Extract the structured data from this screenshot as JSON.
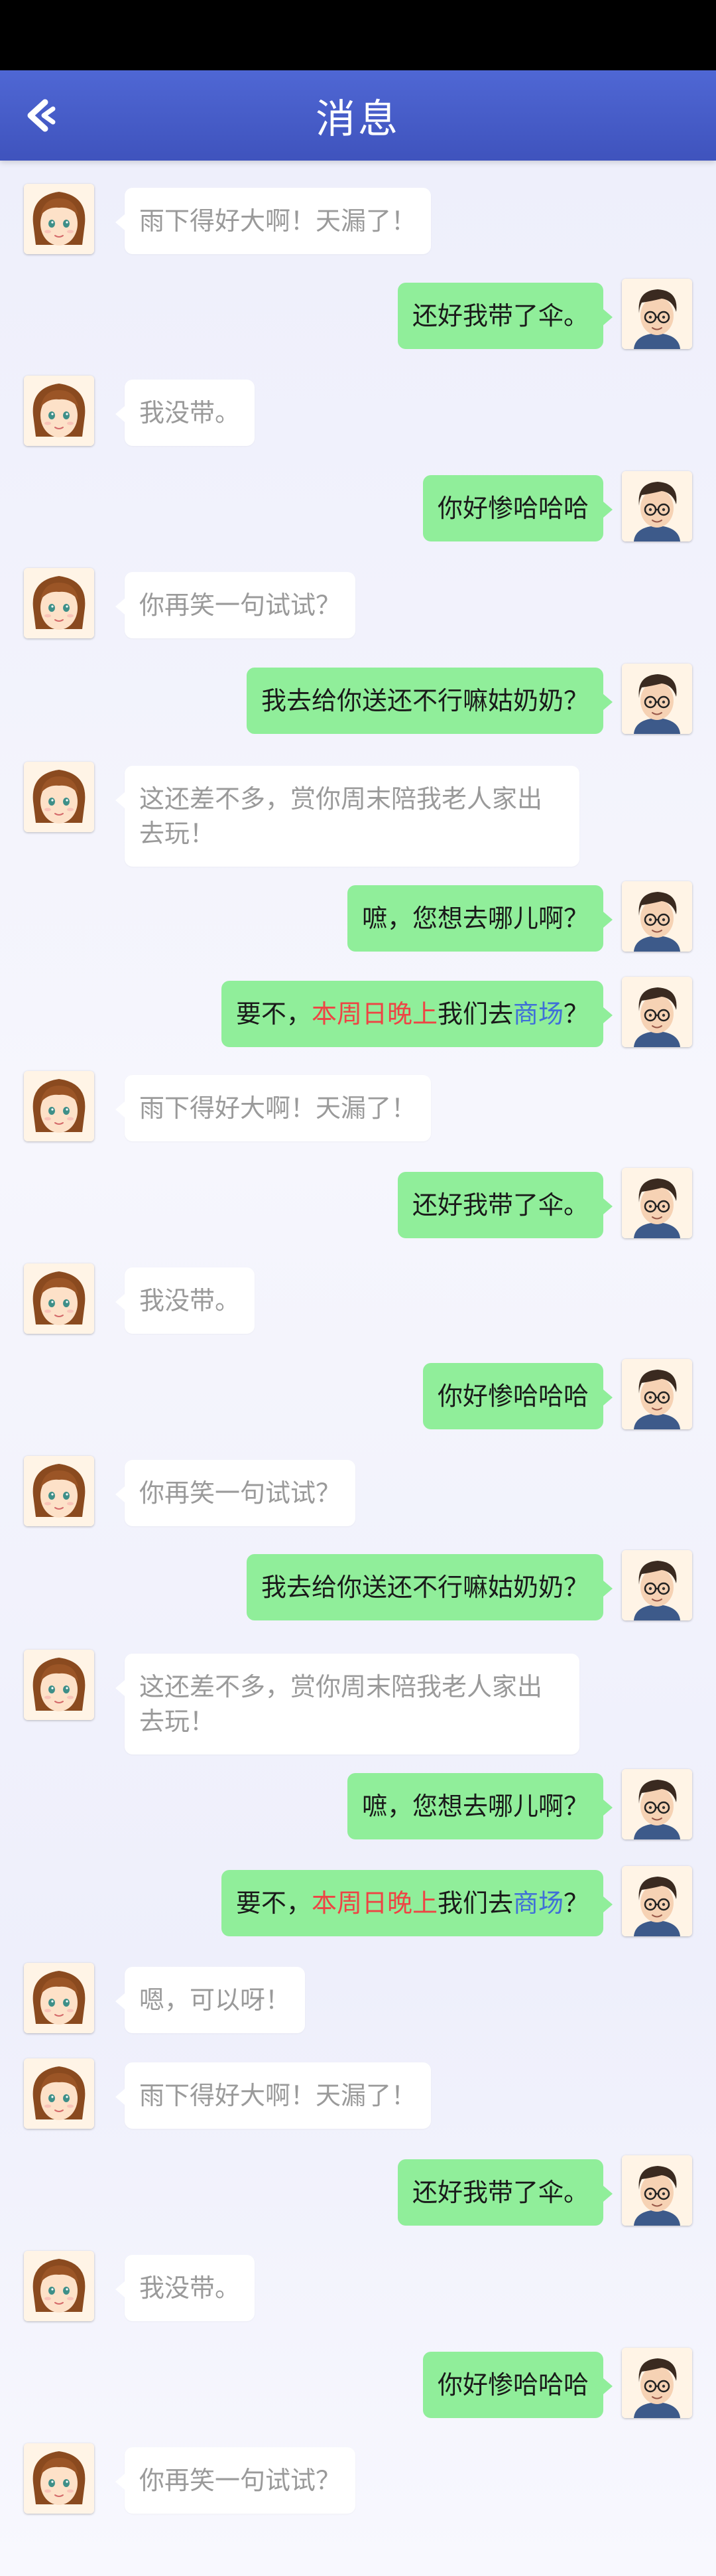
{
  "header": {
    "title": "消息",
    "back_icon": "back-arrow-icon"
  },
  "colors": {
    "header": "#4a5fcd",
    "bubble_self": "#90ee9a",
    "bubble_other": "#ffffff",
    "text_other": "#9a9a9a",
    "highlight_red": "#ee4444",
    "highlight_blue": "#3f6fd8"
  },
  "messages": [
    {
      "side": "left",
      "segments": [
        {
          "text": "雨下得好大啊！天漏了！"
        }
      ]
    },
    {
      "side": "right",
      "segments": [
        {
          "text": "还好我带了伞。"
        }
      ]
    },
    {
      "side": "left",
      "segments": [
        {
          "text": "我没带。"
        }
      ]
    },
    {
      "side": "right",
      "segments": [
        {
          "text": "你好惨哈哈哈"
        }
      ]
    },
    {
      "side": "left",
      "segments": [
        {
          "text": "你再笑一句试试？"
        }
      ]
    },
    {
      "side": "right",
      "segments": [
        {
          "text": "我去给你送还不行嘛姑奶奶？"
        }
      ]
    },
    {
      "side": "left",
      "multi": true,
      "segments": [
        {
          "text": "这还差不多，赏你周末陪我老人家出去玩！"
        }
      ]
    },
    {
      "side": "right",
      "segments": [
        {
          "text": "嗻，您想去哪儿啊？"
        }
      ]
    },
    {
      "side": "right",
      "segments": [
        {
          "text": "要不，"
        },
        {
          "text": "本周日晚上",
          "color": "red"
        },
        {
          "text": "我们去"
        },
        {
          "text": "商场",
          "color": "blue"
        },
        {
          "text": "？"
        }
      ]
    },
    {
      "side": "left",
      "segments": [
        {
          "text": "雨下得好大啊！天漏了！"
        }
      ]
    },
    {
      "side": "right",
      "segments": [
        {
          "text": "还好我带了伞。"
        }
      ]
    },
    {
      "side": "left",
      "segments": [
        {
          "text": "我没带。"
        }
      ]
    },
    {
      "side": "right",
      "segments": [
        {
          "text": "你好惨哈哈哈"
        }
      ]
    },
    {
      "side": "left",
      "segments": [
        {
          "text": "你再笑一句试试？"
        }
      ]
    },
    {
      "side": "right",
      "segments": [
        {
          "text": "我去给你送还不行嘛姑奶奶？"
        }
      ]
    },
    {
      "side": "left",
      "multi": true,
      "segments": [
        {
          "text": "这还差不多，赏你周末陪我老人家出去玩！"
        }
      ]
    },
    {
      "side": "right",
      "segments": [
        {
          "text": "嗻，您想去哪儿啊？"
        }
      ]
    },
    {
      "side": "right",
      "segments": [
        {
          "text": "要不，"
        },
        {
          "text": "本周日晚上",
          "color": "red"
        },
        {
          "text": "我们去"
        },
        {
          "text": "商场",
          "color": "blue"
        },
        {
          "text": "？"
        }
      ]
    },
    {
      "side": "left",
      "segments": [
        {
          "text": "嗯，可以呀！"
        }
      ]
    },
    {
      "side": "left",
      "segments": [
        {
          "text": "雨下得好大啊！天漏了！"
        }
      ]
    },
    {
      "side": "right",
      "segments": [
        {
          "text": "还好我带了伞。"
        }
      ]
    },
    {
      "side": "left",
      "segments": [
        {
          "text": "我没带。"
        }
      ]
    },
    {
      "side": "right",
      "segments": [
        {
          "text": "你好惨哈哈哈"
        }
      ]
    },
    {
      "side": "left",
      "segments": [
        {
          "text": "你再笑一句试试？"
        }
      ]
    }
  ]
}
